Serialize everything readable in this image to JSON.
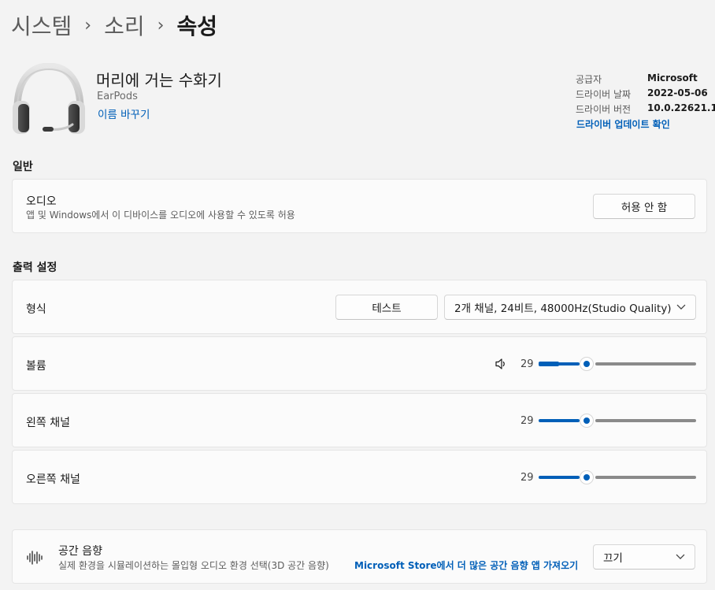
{
  "breadcrumb": {
    "item1": "시스템",
    "item2": "소리",
    "current": "속성",
    "separator": "›"
  },
  "device": {
    "name": "머리에 거는 수화기",
    "model": "EarPods",
    "rename_link": "이름 바꾸기"
  },
  "driver": {
    "provider_label": "공급자",
    "provider_value": "Microsoft",
    "date_label": "드라이버 날짜",
    "date_value": "2022-05-06",
    "version_label": "드라이버 버전",
    "version_value": "10.0.22621.1",
    "update_link": "드라이버 업데이트 확인"
  },
  "general": {
    "heading": "일반",
    "audio_title": "오디오",
    "audio_desc": "앱 및 Windows에서 이 디바이스를 오디오에 사용할 수 있도록 허용",
    "audio_button": "허용 안 함"
  },
  "output": {
    "heading": "출력 설정",
    "format_label": "형식",
    "test_button": "테스트",
    "format_value": "2개 채널, 24비트, 48000Hz(Studio Quality)",
    "volume_label": "볼륨",
    "volume_value": "29",
    "left_label": "왼쪽 채널",
    "left_value": "29",
    "right_label": "오른쪽 채널",
    "right_value": "29"
  },
  "spatial": {
    "title": "공간 음향",
    "desc": "실제 환경을 시뮬레이션하는 몰입형 오디오 환경 선택(3D 공간 음향)",
    "store_link": "Microsoft Store에서 더 많은 공간 음향 앱 가져오기",
    "value": "끄기"
  },
  "icons": {
    "headset": "headset-icon",
    "speaker": "speaker-icon",
    "spatial": "sound-wave-icon",
    "chevron": "chevron-down-icon"
  },
  "colors": {
    "accent": "#005fb8",
    "background": "#f3f3f3",
    "card": "#fbfbfb"
  }
}
